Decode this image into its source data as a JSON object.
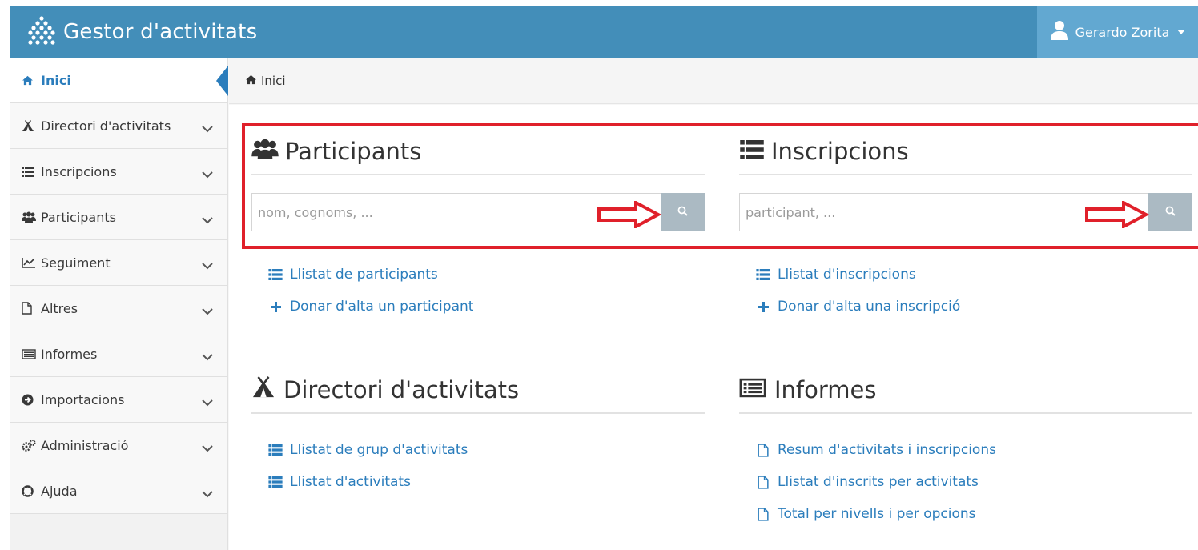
{
  "header": {
    "title": "Gestor d'activitats",
    "user_name": "Gerardo Zorita"
  },
  "sidebar": {
    "items": [
      {
        "label": "Inici"
      },
      {
        "label": "Directori d'activitats"
      },
      {
        "label": "Inscripcions"
      },
      {
        "label": "Participants"
      },
      {
        "label": "Seguiment"
      },
      {
        "label": "Altres"
      },
      {
        "label": "Informes"
      },
      {
        "label": "Importacions"
      },
      {
        "label": "Administració"
      },
      {
        "label": "Ajuda"
      }
    ]
  },
  "breadcrumb": {
    "home": "Inici"
  },
  "participants": {
    "title": "Participants",
    "search_placeholder": "nom, cognoms, ...",
    "link_list": "Llistat de participants",
    "link_add": "Donar d'alta un participant"
  },
  "inscripcions": {
    "title": "Inscripcions",
    "search_placeholder": "participant, ...",
    "link_list": "Llistat d'inscripcions",
    "link_add": "Donar d'alta una inscripció"
  },
  "directori": {
    "title": "Directori d'activitats",
    "link_groups": "Llistat de grup d'activitats",
    "link_activities": "Llistat d'activitats"
  },
  "informes": {
    "title": "Informes",
    "link_summary": "Resum d'activitats i inscripcions",
    "link_enrolled": "Llistat d'inscrits per activitats",
    "link_totals": "Total per nivells i per opcions"
  },
  "colors": {
    "header": "#438eb9",
    "user_box": "#62a8d1",
    "link": "#2b7dbc",
    "highlight": "#e0202a",
    "search_button": "#abbac3"
  }
}
